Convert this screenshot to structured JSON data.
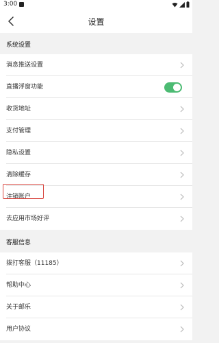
{
  "status_bar": {
    "time": "3:00"
  },
  "nav": {
    "title": "设置"
  },
  "sections": [
    {
      "header": "系统设置",
      "items": [
        {
          "label": "消息推送设置"
        },
        {
          "label": "直播浮窗功能",
          "toggle_on": true
        },
        {
          "label": "收货地址"
        },
        {
          "label": "支付管理"
        },
        {
          "label": "隐私设置"
        },
        {
          "label": "清除缓存"
        },
        {
          "label": "注销账户"
        },
        {
          "label": "去应用市场好评"
        }
      ]
    },
    {
      "header": "客服信息",
      "items": [
        {
          "label": "拨打客服（11185）"
        },
        {
          "label": "帮助中心"
        },
        {
          "label": "关于邮乐"
        },
        {
          "label": "用户协议"
        }
      ]
    }
  ],
  "colors": {
    "toggle_on": "#4cbb73",
    "highlight": "#d8463f",
    "background": "#f2f2f2"
  }
}
